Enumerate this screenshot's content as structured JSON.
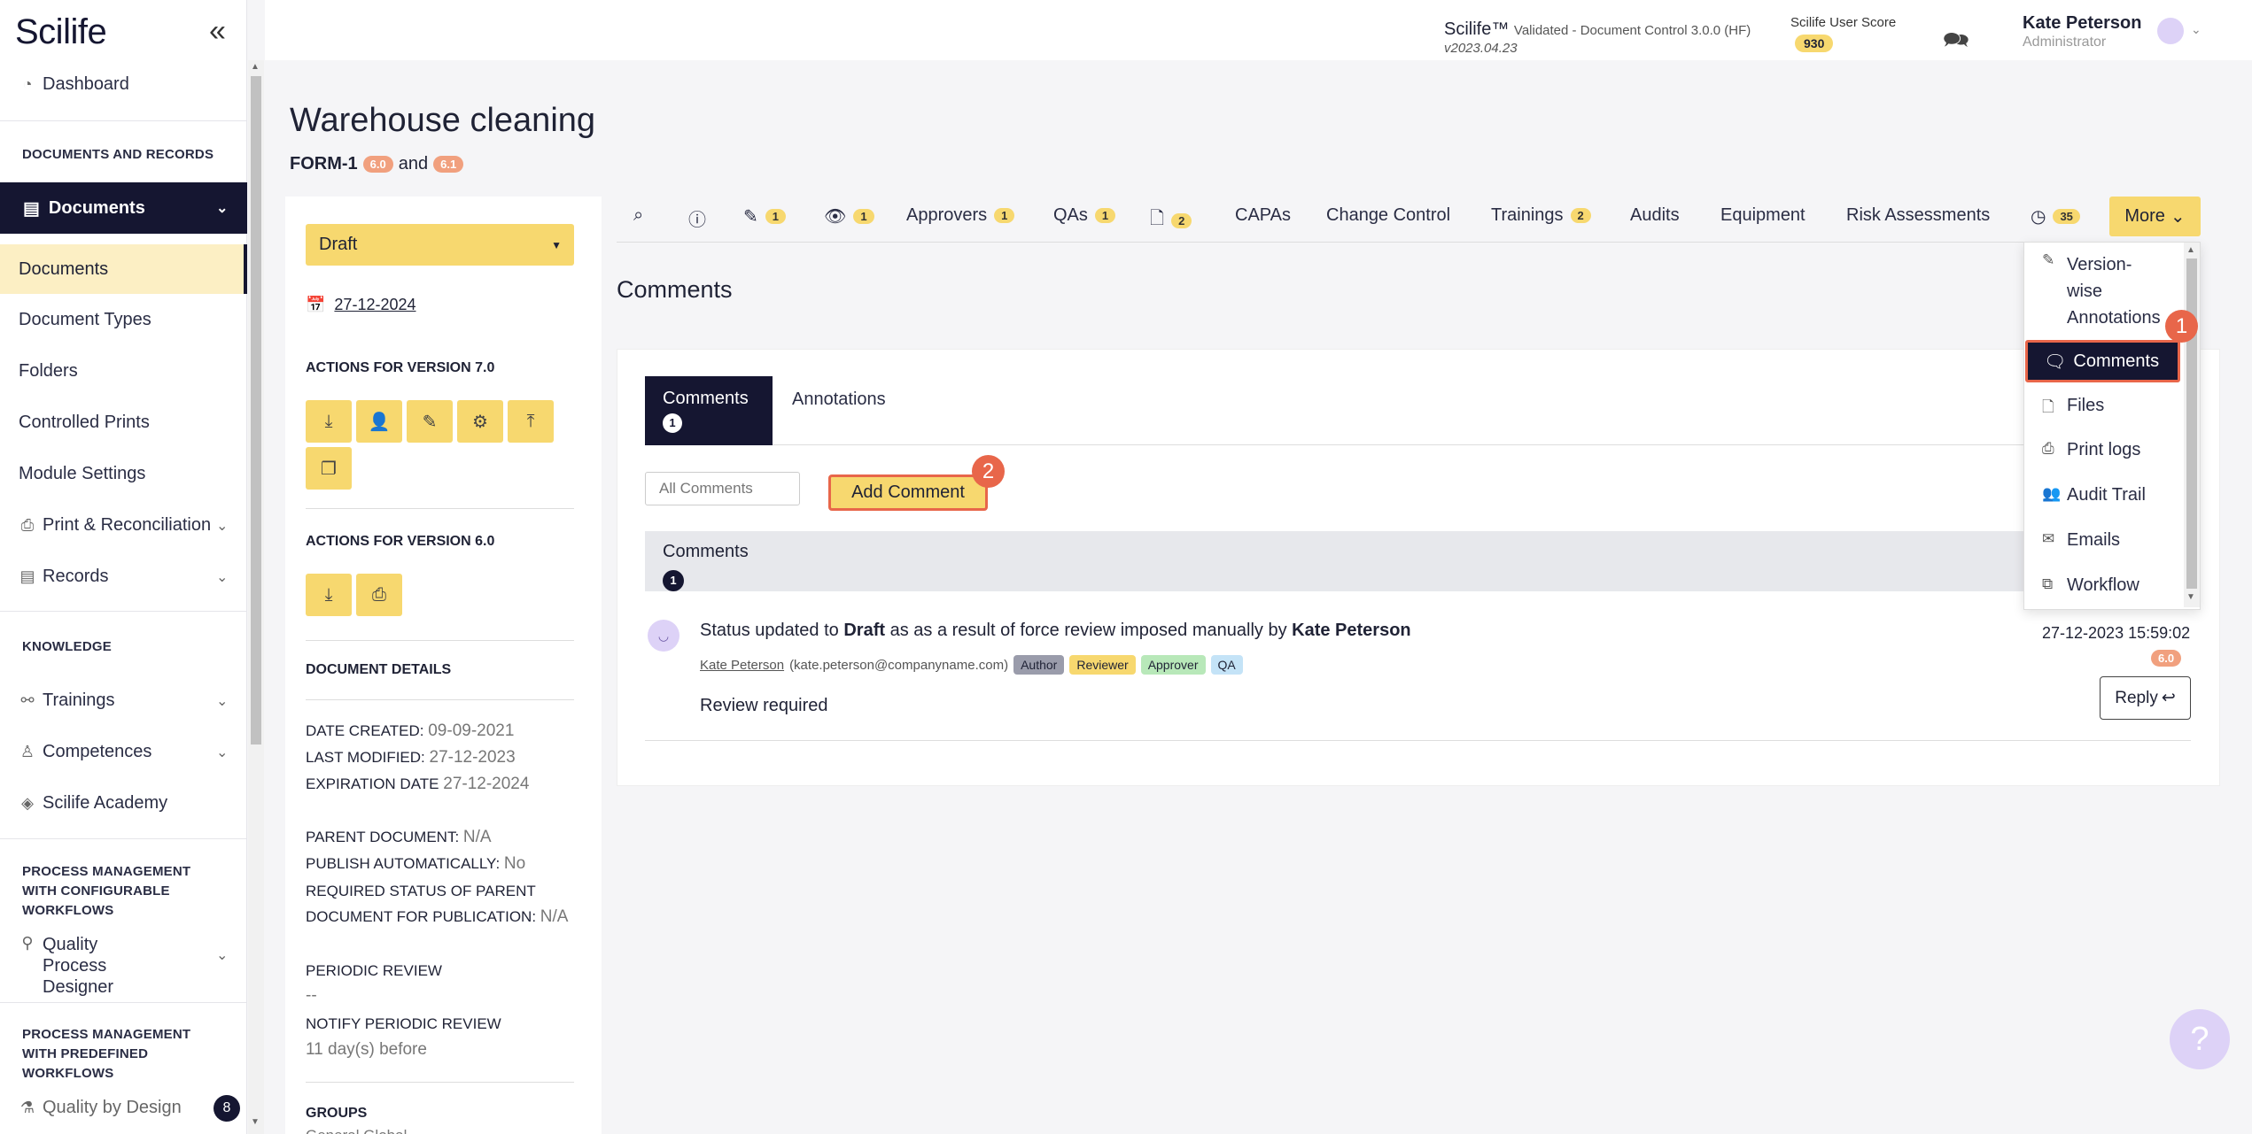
{
  "app": {
    "logo": "Scilife",
    "version_line": "Scilife™",
    "version_detail": "Validated - Document Control 3.0.0 (HF)",
    "build": "v2023.04.23",
    "score_label": "Scilife User Score",
    "score": "930",
    "user_name": "Kate Peterson",
    "user_role": "Administrator"
  },
  "sidebar": {
    "dashboard": "Dashboard",
    "sec_docs": "DOCUMENTS AND RECORDS",
    "documents_group": "Documents",
    "documents_items": [
      "Documents",
      "Document Types",
      "Folders",
      "Controlled Prints",
      "Module Settings"
    ],
    "print_reconciliation": "Print & Reconciliation",
    "records": "Records",
    "sec_knowledge": "KNOWLEDGE",
    "trainings": "Trainings",
    "competences": "Competences",
    "academy": "Scilife Academy",
    "sec_configurable": "PROCESS MANAGEMENT WITH CONFIGURABLE WORKFLOWS",
    "qpd": "Quality Process Designer",
    "sec_predefined": "PROCESS MANAGEMENT WITH PREDEFINED WORKFLOWS",
    "qbd": "Quality by Design",
    "qbd_badge": "8"
  },
  "page": {
    "title": "Warehouse cleaning",
    "form_id": "FORM-1",
    "ver_a": "6.0",
    "and_text": "and",
    "ver_b": "6.1"
  },
  "left_panel": {
    "status": "Draft",
    "date": "27-12-2024",
    "actions_v7": "ACTIONS FOR VERSION 7.0",
    "actions_v6": "ACTIONS FOR VERSION 6.0",
    "doc_details": "DOCUMENT DETAILS",
    "date_created_label": "DATE CREATED:",
    "date_created": "09-09-2021",
    "last_modified_label": "LAST MODIFIED:",
    "last_modified": "27-12-2023",
    "expiration_label": "EXPIRATION DATE",
    "expiration": "27-12-2024",
    "parent_label": "PARENT DOCUMENT:",
    "parent": "N/A",
    "publish_label": "PUBLISH AUTOMATICALLY:",
    "publish": "No",
    "required_label_1": "REQUIRED STATUS OF PARENT",
    "required_label_2": "DOCUMENT FOR PUBLICATION:",
    "required": "N/A",
    "periodic_label": "PERIODIC REVIEW",
    "periodic": "--",
    "notify_label": "NOTIFY PERIODIC REVIEW",
    "notify": "11 day(s) before",
    "groups": "GROUPS",
    "groups_value": "General Global"
  },
  "tabs": {
    "edit_count": "1",
    "view_count": "1",
    "approvers": "Approvers",
    "approvers_count": "1",
    "qas": "QAs",
    "qas_count": "1",
    "files_count": "2",
    "capas": "CAPAs",
    "change_control": "Change Control",
    "trainings": "Trainings",
    "trainings_count": "2",
    "audits": "Audits",
    "equipment": "Equipment",
    "risk": "Risk Assessments",
    "history_count": "35",
    "more": "More"
  },
  "dropdown": {
    "version_annotations_1": "Version-",
    "version_annotations_2": "wise",
    "version_annotations_3": "Annotations",
    "comments": "Comments",
    "files": "Files",
    "print_logs": "Print logs",
    "audit_trail": "Audit Trail",
    "emails": "Emails",
    "workflow": "Workflow"
  },
  "comments": {
    "heading": "Comments",
    "tab_comments": "Comments",
    "tab_comments_count": "1",
    "tab_annotations": "Annotations",
    "filter": "All Comments",
    "add_button": "Add Comment",
    "list_header": "Comments",
    "list_count": "1",
    "item": {
      "pre": "Status updated to",
      "status": "Draft",
      "mid": "as as a result of force review imposed manually by",
      "by": "Kate Peterson",
      "author": "Kate Peterson",
      "email": "(kate.peterson@companyname.com)",
      "roles": [
        "Author",
        "Reviewer",
        "Approver",
        "QA"
      ],
      "body": "Review required",
      "date": "27-12-2023 15:59:02",
      "version": "6.0",
      "reply": "Reply"
    }
  },
  "steps": {
    "one": "1",
    "two": "2"
  },
  "help": "?"
}
